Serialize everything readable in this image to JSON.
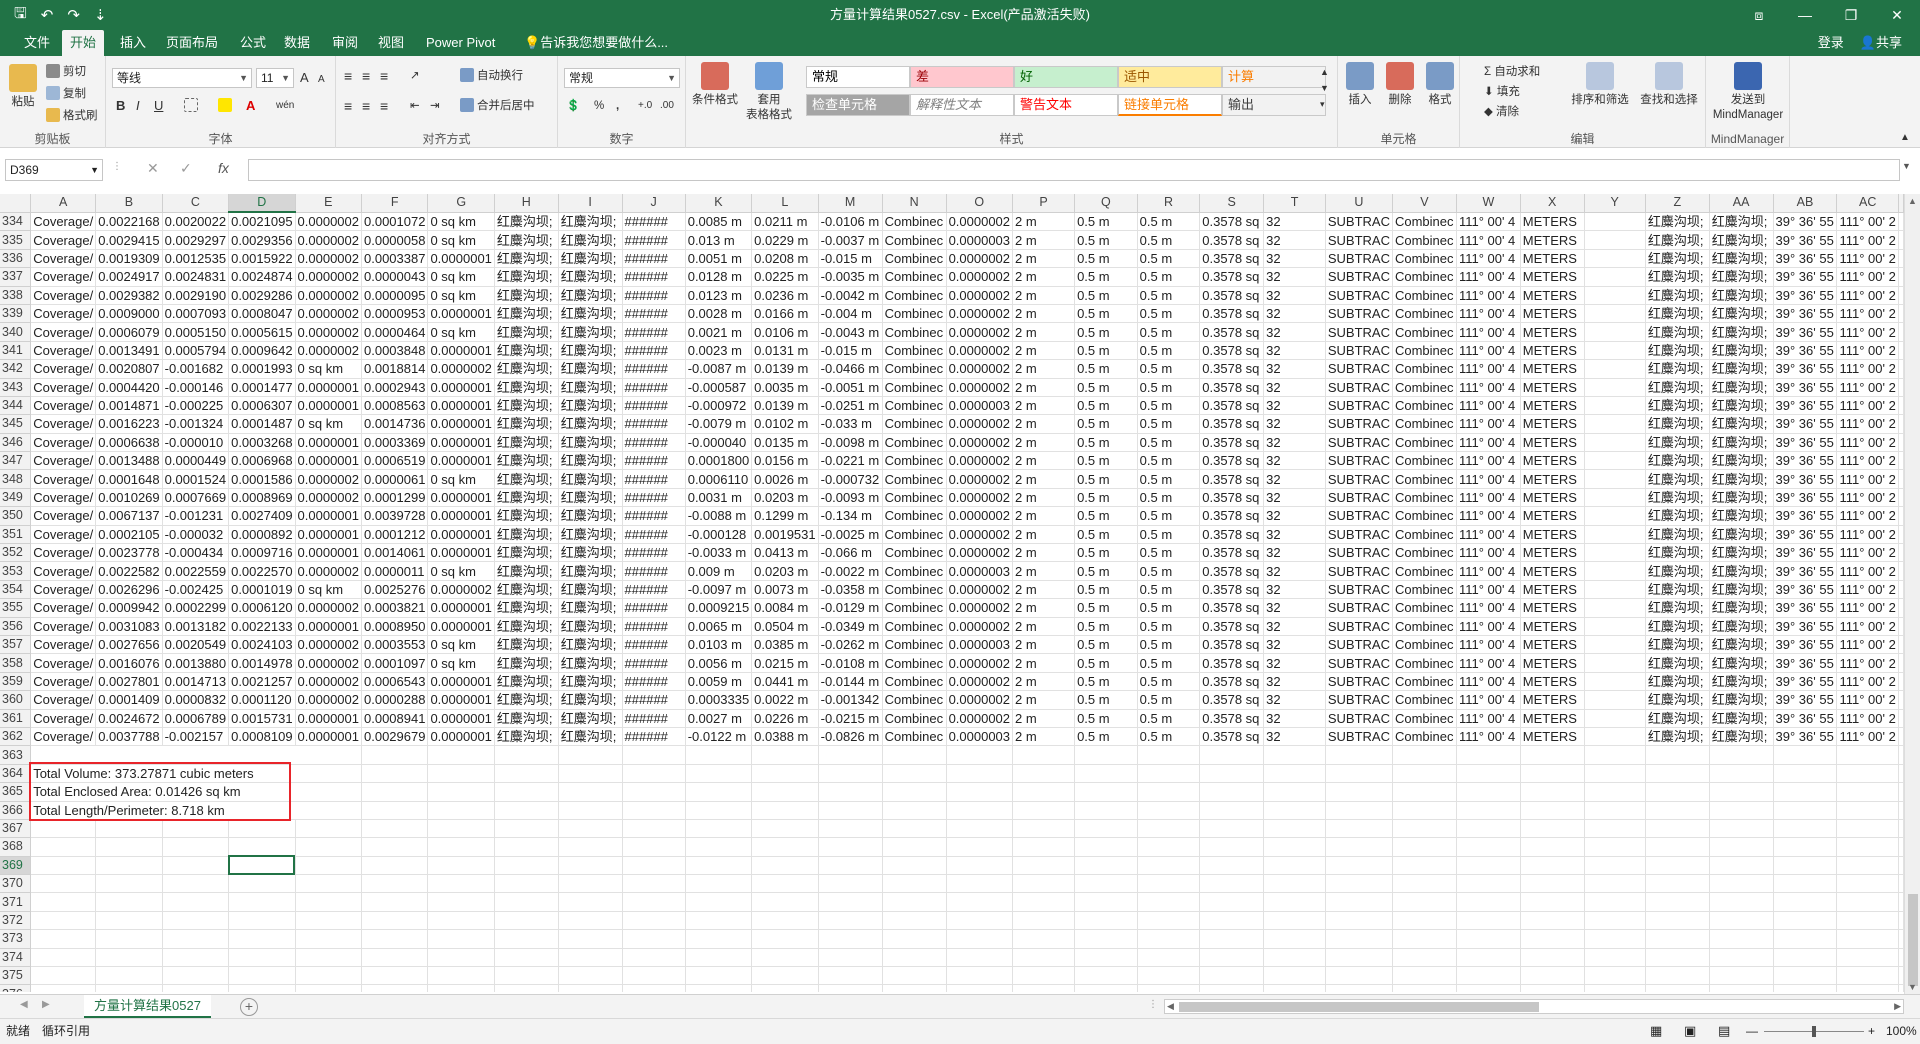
{
  "titlebar": {
    "title": "方量计算结果0527.csv - Excel(产品激活失败)",
    "save_icon": "save-icon",
    "undo_icon": "undo-icon",
    "redo_icon": "redo-icon",
    "customize": "⇣",
    "ribbon_display": "⧈",
    "minimize": "—",
    "restore": "❐",
    "close": "✕"
  },
  "tabs": [
    "文件",
    "开始",
    "插入",
    "页面布局",
    "公式",
    "数据",
    "审阅",
    "视图",
    "Power Pivot",
    "告诉我您想要做什么..."
  ],
  "account": {
    "login": "登录",
    "share": "共享"
  },
  "ribbon": {
    "clipboard": {
      "paste": "粘贴",
      "cut": "剪切",
      "copy": "复制",
      "format_painter": "格式刷",
      "label": "剪贴板"
    },
    "font": {
      "name": "等线",
      "size": "11",
      "grow": "A",
      "shrink": "A",
      "bold": "B",
      "italic": "I",
      "underline": "U",
      "label": "字体",
      "pinyin": "wén"
    },
    "alignment": {
      "wrap": "自动换行",
      "merge": "合并后居中",
      "label": "对齐方式"
    },
    "number": {
      "format": "常规",
      "percent": "%",
      "comma": ",",
      "label": "数字"
    },
    "styles": {
      "conditional": "条件格式",
      "table": "套用\n表格格式",
      "cells": [
        {
          "text": "常规",
          "bg": "#ffffff",
          "color": "#000000"
        },
        {
          "text": "差",
          "bg": "#ffc7ce",
          "color": "#9c0006"
        },
        {
          "text": "好",
          "bg": "#c6efce",
          "color": "#006100"
        },
        {
          "text": "适中",
          "bg": "#ffeb9c",
          "color": "#9c5700"
        },
        {
          "text": "计算",
          "bg": "#f2f2f2",
          "color": "#fa7d00"
        },
        {
          "text": "检查单元格",
          "bg": "#a5a5a5",
          "color": "#ffffff"
        },
        {
          "text": "解释性文本",
          "bg": "#ffffff",
          "color": "#7f7f7f"
        },
        {
          "text": "警告文本",
          "bg": "#ffffff",
          "color": "#ff0000"
        },
        {
          "text": "链接单元格",
          "bg": "#ffffff",
          "color": "#fa7d00"
        },
        {
          "text": "输出",
          "bg": "#f2f2f2",
          "color": "#3f3f3f"
        }
      ],
      "label": "样式"
    },
    "cells": {
      "insert": "插入",
      "delete": "删除",
      "format": "格式",
      "label": "单元格"
    },
    "editing": {
      "autosum": "自动求和",
      "fill": "填充",
      "clear": "清除",
      "sort": "排序和筛选",
      "find": "查找和选择",
      "label": "编辑"
    },
    "mindmanager": {
      "send": "发送到\nMindManager",
      "label": "MindManager"
    }
  },
  "formula_bar": {
    "name_box": "D369",
    "cancel": "✕",
    "enter": "✓",
    "fx": "fx",
    "value": ""
  },
  "columns": [
    "A",
    "B",
    "C",
    "D",
    "E",
    "F",
    "G",
    "H",
    "I",
    "J",
    "K",
    "L",
    "M",
    "N",
    "O",
    "P",
    "Q",
    "R",
    "S",
    "T",
    "U",
    "V",
    "W",
    "X",
    "Y",
    "Z",
    "AA",
    "AB",
    "AC"
  ],
  "selected_cell": "D369",
  "data_rows": [
    [
      334,
      "0.0022168",
      "0.0020022",
      "0.0021095",
      "0.0000002",
      "0.0001072",
      "0 sq km",
      "0.0085 m",
      "0.0211 m",
      "-0.0106 m"
    ],
    [
      335,
      "0.0029415",
      "0.0029297",
      "0.0029356",
      "0.0000002",
      "0.0000058",
      "0 sq km",
      "0.013 m",
      "0.0229 m",
      "-0.0037 m"
    ],
    [
      336,
      "0.0019309",
      "0.0012535",
      "0.0015922",
      "0.0000002",
      "0.0003387",
      "0.0000001",
      "0.0051 m",
      "0.0208 m",
      "-0.015 m"
    ],
    [
      337,
      "0.0024917",
      "0.0024831",
      "0.0024874",
      "0.0000002",
      "0.0000043",
      "0 sq km",
      "0.0128 m",
      "0.0225 m",
      "-0.0035 m"
    ],
    [
      338,
      "0.0029382",
      "0.0029190",
      "0.0029286",
      "0.0000002",
      "0.0000095",
      "0 sq km",
      "0.0123 m",
      "0.0236 m",
      "-0.0042 m"
    ],
    [
      339,
      "0.0009000",
      "0.0007093",
      "0.0008047",
      "0.0000002",
      "0.0000953",
      "0.0000001",
      "0.0028 m",
      "0.0166 m",
      "-0.004 m"
    ],
    [
      340,
      "0.0006079",
      "0.0005150",
      "0.0005615",
      "0.0000002",
      "0.0000464",
      "0 sq km",
      "0.0021 m",
      "0.0106 m",
      "-0.0043 m"
    ],
    [
      341,
      "0.0013491",
      "0.0005794",
      "0.0009642",
      "0.0000002",
      "0.0003848",
      "0.0000001",
      "0.0023 m",
      "0.0131 m",
      "-0.015 m"
    ],
    [
      342,
      "0.0020807",
      "-0.001682",
      "0.0001993",
      "0 sq km",
      "0.0018814",
      "0.0000002",
      "-0.0087 m",
      "0.0139 m",
      "-0.0466 m"
    ],
    [
      343,
      "0.0004420",
      "-0.000146",
      "0.0001477",
      "0.0000001",
      "0.0002943",
      "0.0000001",
      "-0.000587",
      "0.0035 m",
      "-0.0051 m"
    ],
    [
      344,
      "0.0014871",
      "-0.000225",
      "0.0006307",
      "0.0000001",
      "0.0008563",
      "0.0000001",
      "-0.000972",
      "0.0139 m",
      "-0.0251 m"
    ],
    [
      345,
      "0.0016223",
      "-0.001324",
      "0.0001487",
      "0 sq km",
      "0.0014736",
      "0.0000001",
      "-0.0079 m",
      "0.0102 m",
      "-0.033 m"
    ],
    [
      346,
      "0.0006638",
      "-0.000010",
      "0.0003268",
      "0.0000001",
      "0.0003369",
      "0.0000001",
      "-0.000040",
      "0.0135 m",
      "-0.0098 m"
    ],
    [
      347,
      "0.0013488",
      "0.0000449",
      "0.0006968",
      "0.0000001",
      "0.0006519",
      "0.0000001",
      "0.0001800",
      "0.0156 m",
      "-0.0221 m"
    ],
    [
      348,
      "0.0001648",
      "0.0001524",
      "0.0001586",
      "0.0000002",
      "0.0000061",
      "0 sq km",
      "0.0006110",
      "0.0026 m",
      "-0.000732"
    ],
    [
      349,
      "0.0010269",
      "0.0007669",
      "0.0008969",
      "0.0000002",
      "0.0001299",
      "0.0000001",
      "0.0031 m",
      "0.0203 m",
      "-0.0093 m"
    ],
    [
      350,
      "0.0067137",
      "-0.001231",
      "0.0027409",
      "0.0000001",
      "0.0039728",
      "0.0000001",
      "-0.0088 m",
      "0.1299 m",
      "-0.134 m"
    ],
    [
      351,
      "0.0002105",
      "-0.000032",
      "0.0000892",
      "0.0000001",
      "0.0001212",
      "0.0000001",
      "-0.000128",
      "0.0019531",
      "-0.0025 m"
    ],
    [
      352,
      "0.0023778",
      "-0.000434",
      "0.0009716",
      "0.0000001",
      "0.0014061",
      "0.0000001",
      "-0.0033 m",
      "0.0413 m",
      "-0.066 m"
    ],
    [
      353,
      "0.0022582",
      "0.0022559",
      "0.0022570",
      "0.0000002",
      "0.0000011",
      "0 sq km",
      "0.009 m",
      "0.0203 m",
      "-0.0022 m"
    ],
    [
      354,
      "0.0026296",
      "-0.002425",
      "0.0001019",
      "0 sq km",
      "0.0025276",
      "0.0000002",
      "-0.0097 m",
      "0.0073 m",
      "-0.0358 m"
    ],
    [
      355,
      "0.0009942",
      "0.0002299",
      "0.0006120",
      "0.0000002",
      "0.0003821",
      "0.0000001",
      "0.0009215",
      "0.0084 m",
      "-0.0129 m"
    ],
    [
      356,
      "0.0031083",
      "0.0013182",
      "0.0022133",
      "0.0000001",
      "0.0008950",
      "0.0000001",
      "0.0065 m",
      "0.0504 m",
      "-0.0349 m"
    ],
    [
      357,
      "0.0027656",
      "0.0020549",
      "0.0024103",
      "0.0000002",
      "0.0003553",
      "0 sq km",
      "0.0103 m",
      "0.0385 m",
      "-0.0262 m"
    ],
    [
      358,
      "0.0016076",
      "0.0013880",
      "0.0014978",
      "0.0000002",
      "0.0001097",
      "0 sq km",
      "0.0056 m",
      "0.0215 m",
      "-0.0108 m"
    ],
    [
      359,
      "0.0027801",
      "0.0014713",
      "0.0021257",
      "0.0000002",
      "0.0006543",
      "0.0000001",
      "0.0059 m",
      "0.0441 m",
      "-0.0144 m"
    ],
    [
      360,
      "0.0001409",
      "0.0000832",
      "0.0001120",
      "0.0000002",
      "0.0000288",
      "0.0000001",
      "0.0003335",
      "0.0022 m",
      "-0.001342"
    ],
    [
      361,
      "0.0024672",
      "0.0006789",
      "0.0015731",
      "0.0000001",
      "0.0008941",
      "0.0000001",
      "0.0027 m",
      "0.0226 m",
      "-0.0215 m"
    ],
    [
      362,
      "0.0037788",
      "-0.002157",
      "0.0008109",
      "0.0000001",
      "0.0029679",
      "0.0000001",
      "-0.0122 m",
      "0.0388 m",
      "-0.0826 m"
    ]
  ],
  "row_constants": {
    "a": "Coverage/",
    "h": "红麋沟坝;",
    "i": "红麋沟坝;",
    "j": "######",
    "n": "Combinec",
    "o_values": [
      "0.0000002",
      "0.0000003",
      "0.0000002",
      "0.0000002",
      "0.0000002",
      "0.0000002",
      "0.0000002",
      "0.0000002",
      "0.0000002",
      "0.0000002",
      "0.0000003",
      "0.0000002",
      "0.0000002",
      "0.0000002",
      "0.0000002",
      "0.0000002",
      "0.0000002",
      "0.0000002",
      "0.0000002",
      "0.0000003",
      "0.0000002",
      "0.0000002",
      "0.0000002",
      "0.0000003",
      "0.0000002",
      "0.0000002",
      "0.0000002",
      "0.0000002",
      "0.0000003"
    ],
    "p": "2 m",
    "q": "0.5 m",
    "r": "0.5 m",
    "s": "0.3578 sq",
    "t": "32",
    "u": "SUBTRAC",
    "v": "Combinec",
    "w": "111° 00' 4",
    "x": "METERS",
    "z": "红麋沟坝;",
    "aa": "红麋沟坝;",
    "ab": "39° 36' 55",
    "ac": "111° 00' 2"
  },
  "summary": [
    {
      "row": 363,
      "text": ""
    },
    {
      "row": 364,
      "text": "Total Volume: 373.27871 cubic meters"
    },
    {
      "row": 365,
      "text": "Total Enclosed Area: 0.01426 sq km"
    },
    {
      "row": 366,
      "text": "Total Length/Perimeter: 8.718 km"
    }
  ],
  "empty_rows": [
    367,
    368,
    369,
    370,
    371,
    372,
    373,
    374,
    375,
    376
  ],
  "sheet": {
    "tab": "方量计算结果0527",
    "add": "+"
  },
  "status": {
    "ready": "就绪",
    "circular": "循环引用",
    "zoom": "100%",
    "zoom_minus": "—",
    "zoom_plus": "+"
  },
  "colors": {
    "accent": "#217346",
    "highlight": "#e8242a"
  }
}
